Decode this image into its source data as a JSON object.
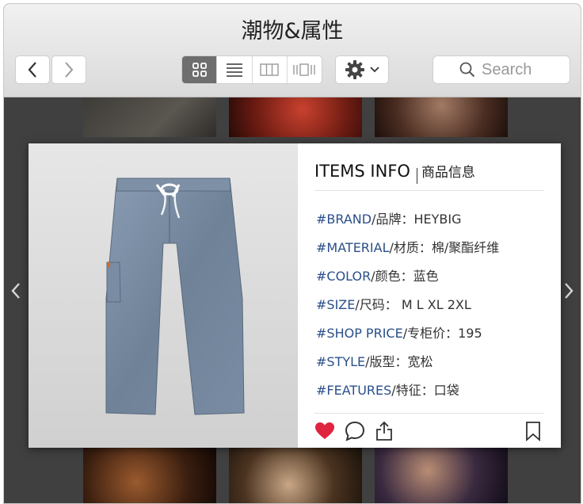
{
  "window": {
    "title": "潮物&属性"
  },
  "toolbar": {
    "search_placeholder": "Search",
    "view_modes": [
      "grid",
      "list",
      "columns",
      "coverflow"
    ],
    "active_view": "grid"
  },
  "card": {
    "title": "ITEMS INFO",
    "subtitle": "商品信息",
    "attributes": [
      {
        "key": "#BRAND",
        "value": "/品牌：HEYBIG"
      },
      {
        "key": "#MATERIAL",
        "value": "/材质：棉/聚酯纤维"
      },
      {
        "key": "#COLOR",
        "value": "/颜色：蓝色"
      },
      {
        "key": "#SIZE",
        "value": "/尺码： M L XL 2XL"
      },
      {
        "key": "#SHOP PRICE",
        "value": "/专柜价：195"
      },
      {
        "key": "#STYLE",
        "value": "/版型：宽松"
      },
      {
        "key": "#FEATURES",
        "value": "/特征：口袋"
      }
    ],
    "liked": true
  },
  "colors": {
    "accent_link": "#2a4f8a",
    "like_red": "#e0243f",
    "active_view_bg": "#6e6e6e"
  }
}
